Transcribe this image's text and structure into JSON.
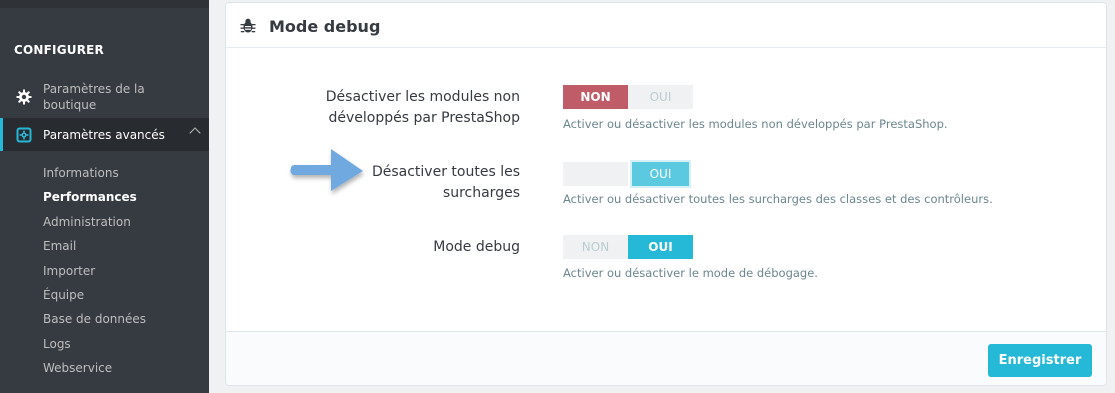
{
  "sidebar": {
    "section_heading": "CONFIGURER",
    "items": [
      {
        "label": "Paramètres de la boutique",
        "icon": "gear-icon"
      },
      {
        "label": "Paramètres avancés",
        "icon": "settings-box-icon",
        "active": true
      }
    ],
    "submenu": [
      {
        "label": "Informations"
      },
      {
        "label": "Performances",
        "active": true
      },
      {
        "label": "Administration"
      },
      {
        "label": "Email"
      },
      {
        "label": "Importer"
      },
      {
        "label": "Équipe"
      },
      {
        "label": "Base de données"
      },
      {
        "label": "Logs"
      },
      {
        "label": "Webservice"
      }
    ]
  },
  "panel": {
    "title": "Mode debug",
    "icon": "bug-icon",
    "rows": [
      {
        "label_line1": "Désactiver les modules non",
        "label_line2": "développés par PrestaShop",
        "no_label": "NON",
        "yes_label": "OUI",
        "selected": "NON",
        "help": "Activer ou désactiver les modules non développés par PrestaShop."
      },
      {
        "label_line1": "Désactiver toutes les",
        "label_line2": "surcharges",
        "no_label": "",
        "yes_label": "OUI",
        "selected": "OUI",
        "help": "Activer ou désactiver toutes les surcharges des classes et des contrôleurs."
      },
      {
        "label_line1": "Mode debug",
        "no_label": "NON",
        "yes_label": "OUI",
        "selected": "OUI",
        "help": "Activer ou désactiver le mode de débogage."
      }
    ],
    "save_label": "Enregistrer"
  },
  "colors": {
    "sidebar_bg": "#363a41",
    "accent": "#25b9d7",
    "danger": "#c05c67",
    "arrow": "#6fa8e0"
  }
}
